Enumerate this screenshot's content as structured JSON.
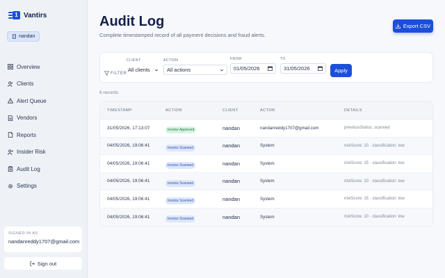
{
  "brand": {
    "name": "Vantirs",
    "logo_glyph": "1"
  },
  "user_chip": {
    "label": "nandan"
  },
  "nav": [
    {
      "label": "Overview",
      "icon": "grid-icon"
    },
    {
      "label": "Clients",
      "icon": "users-icon"
    },
    {
      "label": "Alert Queue",
      "icon": "alert-triangle-icon"
    },
    {
      "label": "Vendors",
      "icon": "document-icon"
    },
    {
      "label": "Reports",
      "icon": "file-icon"
    },
    {
      "label": "Insider Risk",
      "icon": "user-risk-icon"
    },
    {
      "label": "Audit Log",
      "icon": "clipboard-icon"
    },
    {
      "label": "Settings",
      "icon": "gear-icon"
    }
  ],
  "signed_in": {
    "label": "SIGNED IN AS",
    "email": "nandanreddy1707@gmail.com"
  },
  "signout": {
    "label": "Sign out"
  },
  "page": {
    "title": "Audit Log",
    "subtitle": "Complete timestamped record of all payment decisions and fraud alerts.",
    "export_label": "Export CSV"
  },
  "filters": {
    "label": "FILTER",
    "client_label": "CLIENT",
    "client_value": "All clients",
    "action_label": "ACTION",
    "action_value": "All actions",
    "from_label": "FROM",
    "from_value": "01/05/2026",
    "to_label": "TO",
    "to_value": "31/05/2026",
    "apply_label": "Apply"
  },
  "records_count": "6 records",
  "table": {
    "headers": [
      "TIMESTAMP",
      "ACTION",
      "CLIENT",
      "ACTOR",
      "DETAILS"
    ],
    "rows": [
      {
        "timestamp": "31/05/2026, 17:13:07",
        "action": "Invoice Approved",
        "action_type": "approved",
        "client": "nandan",
        "actor": "nandanreddy1707@gmail.com",
        "details": "previousStatus: scanned"
      },
      {
        "timestamp": "04/05/2026, 19:06:41",
        "action": "Invoice Scanned",
        "action_type": "scanned",
        "client": "nandan",
        "actor": "System",
        "details": "riskScore: 10 · classification: low"
      },
      {
        "timestamp": "04/05/2026, 19:06:41",
        "action": "Invoice Scanned",
        "action_type": "scanned",
        "client": "nandan",
        "actor": "System",
        "details": "riskScore: 15 · classification: low"
      },
      {
        "timestamp": "04/05/2026, 19:06:41",
        "action": "Invoice Scanned",
        "action_type": "scanned",
        "client": "nandan",
        "actor": "System",
        "details": "riskScore: 10 · classification: low"
      },
      {
        "timestamp": "04/05/2026, 19:06:41",
        "action": "Invoice Scanned",
        "action_type": "scanned",
        "client": "nandan",
        "actor": "System",
        "details": "riskScore: 15 · classification: low"
      },
      {
        "timestamp": "04/05/2026, 19:06:41",
        "action": "Invoice Scanned",
        "action_type": "scanned",
        "client": "nandan",
        "actor": "System",
        "details": "riskScore: 10 · classification: low"
      }
    ]
  },
  "colors": {
    "accent": "#1b4fd8",
    "approved_bg": "#d8f3e2",
    "scanned_bg": "#dde6fb"
  }
}
